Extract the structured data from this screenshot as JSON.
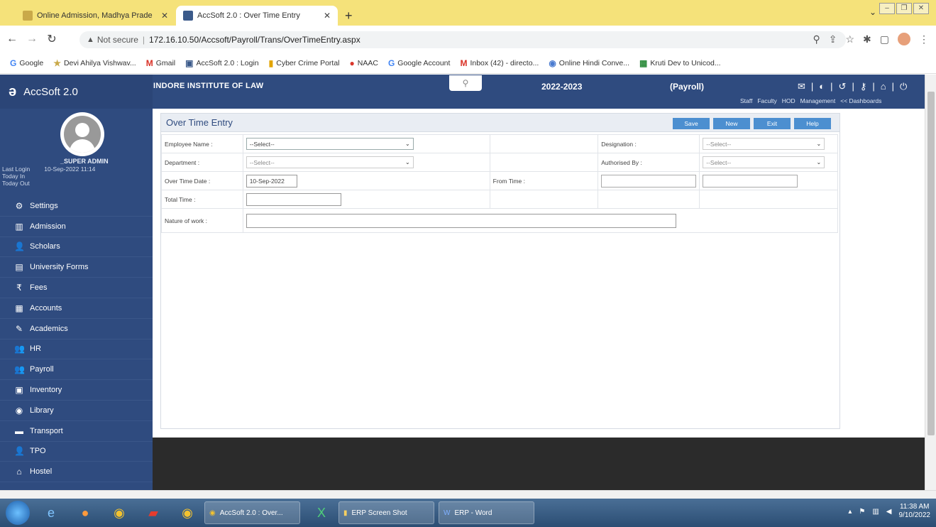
{
  "browser": {
    "tabs": [
      {
        "label": "Online Admission, Madhya Prade"
      },
      {
        "label": "AccSoft 2.0 : Over Time Entry"
      }
    ],
    "new_tab": "+",
    "url_prefix": "Not secure",
    "url": "172.16.10.50/Accsoft/Payroll/Trans/OverTimeEntry.aspx",
    "bookmarks": [
      {
        "icon": "G",
        "label": "Google"
      },
      {
        "icon": "★",
        "label": "Devi Ahilya Vishwav..."
      },
      {
        "icon": "M",
        "label": "Gmail"
      },
      {
        "icon": "▣",
        "label": "AccSoft 2.0 : Login"
      },
      {
        "icon": "▮",
        "label": "Cyber Crime Portal"
      },
      {
        "icon": "●",
        "label": "NAAC"
      },
      {
        "icon": "G",
        "label": "Google Account"
      },
      {
        "icon": "M",
        "label": "Inbox (42) - directo..."
      },
      {
        "icon": "◉",
        "label": "Online Hindi Conve..."
      },
      {
        "icon": "▦",
        "label": "Kruti Dev to Unicod..."
      }
    ]
  },
  "app": {
    "logo_text": "AccSoft 2.0",
    "institute": "INDORE INSTITUTE OF LAW",
    "session": "2022-2023",
    "module": "(Payroll)",
    "top_links": [
      "Staff",
      "Faculty",
      "HOD",
      "Management",
      "<< Dashboards"
    ],
    "user": {
      "name": "_SUPER ADMIN",
      "last_login_label": "Last Login",
      "last_login_value": "10-Sep-2022 11:14",
      "today_in": "Today In",
      "today_out": "Today Out"
    },
    "menu": [
      {
        "icon": "gear-icon",
        "glyph": "⚙",
        "label": "Settings"
      },
      {
        "icon": "admission-icon",
        "glyph": "▥",
        "label": "Admission"
      },
      {
        "icon": "user-icon",
        "glyph": "👤",
        "label": "Scholars"
      },
      {
        "icon": "form-icon",
        "glyph": "▤",
        "label": "University Forms"
      },
      {
        "icon": "rupee-icon",
        "glyph": "₹",
        "label": "Fees"
      },
      {
        "icon": "accounts-icon",
        "glyph": "▦",
        "label": "Accounts"
      },
      {
        "icon": "pencil-icon",
        "glyph": "✎",
        "label": "Academics"
      },
      {
        "icon": "users-icon",
        "glyph": "👥",
        "label": "HR"
      },
      {
        "icon": "users-icon",
        "glyph": "👥",
        "label": "Payroll"
      },
      {
        "icon": "inventory-icon",
        "glyph": "▣",
        "label": "Inventory"
      },
      {
        "icon": "library-icon",
        "glyph": "◉",
        "label": "Library"
      },
      {
        "icon": "bus-icon",
        "glyph": "▬",
        "label": "Transport"
      },
      {
        "icon": "user-icon",
        "glyph": "👤",
        "label": "TPO"
      },
      {
        "icon": "home-icon",
        "glyph": "⌂",
        "label": "Hostel"
      }
    ]
  },
  "form": {
    "title": "Over Time Entry",
    "buttons": {
      "save": "Save",
      "new": "New",
      "exit": "Exit",
      "help": "Help"
    },
    "employee_label": "Employee Name :",
    "employee_value": "--Select--",
    "designation_label": "Designation :",
    "designation_value": "--Select--",
    "department_label": "Department :",
    "department_value": "--Select--",
    "authorised_label": "Authorised By :",
    "authorised_value": "--Select--",
    "date_label": "Over Time Date :",
    "date_value": "10-Sep-2022",
    "from_time_label": "From Time :",
    "total_time_label": "Total Time :",
    "nature_label": "Nature of work :"
  },
  "taskbar": {
    "tasks": [
      {
        "label": "AccSoft 2.0 : Over..."
      },
      {
        "label": "ERP Screen Shot"
      },
      {
        "label": "ERP - Word"
      }
    ],
    "time": "11:38 AM",
    "date": "9/10/2022"
  }
}
